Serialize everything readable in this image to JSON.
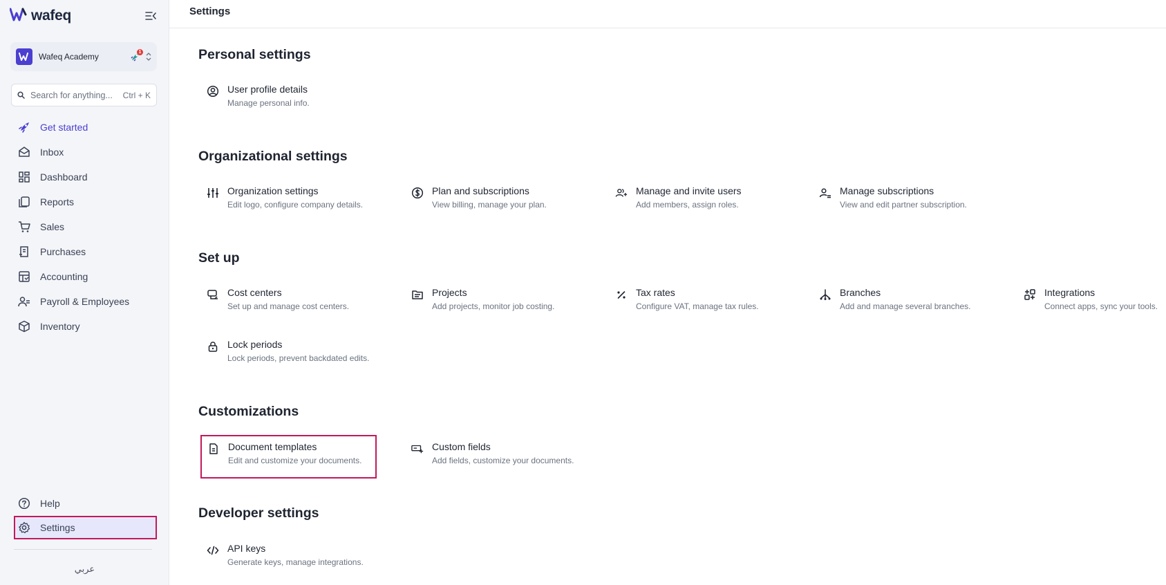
{
  "sidebar": {
    "logo_text": "wafeq",
    "org_name": "Wafeq Academy",
    "org_badge": "1",
    "search_placeholder": "Search for anything...",
    "search_shortcut": "Ctrl + K",
    "nav_items": [
      {
        "label": "Get started",
        "icon": "rocket-icon"
      },
      {
        "label": "Inbox",
        "icon": "inbox-icon"
      },
      {
        "label": "Dashboard",
        "icon": "dashboard-icon"
      },
      {
        "label": "Reports",
        "icon": "reports-icon"
      },
      {
        "label": "Sales",
        "icon": "cart-icon"
      },
      {
        "label": "Purchases",
        "icon": "receipt-icon"
      },
      {
        "label": "Accounting",
        "icon": "ledger-icon"
      },
      {
        "label": "Payroll & Employees",
        "icon": "people-icon"
      },
      {
        "label": "Inventory",
        "icon": "box-icon"
      }
    ],
    "help_label": "Help",
    "settings_label": "Settings",
    "language_label": "عربي"
  },
  "header": {
    "title": "Settings"
  },
  "sections": {
    "personal": {
      "title": "Personal settings",
      "items": [
        {
          "title": "User profile details",
          "desc": "Manage personal info."
        }
      ]
    },
    "organizational": {
      "title": "Organizational settings",
      "items": [
        {
          "title": "Organization settings",
          "desc": "Edit logo, configure company details."
        },
        {
          "title": "Plan and subscriptions",
          "desc": "View billing, manage your plan."
        },
        {
          "title": "Manage and invite users",
          "desc": "Add members, assign roles."
        },
        {
          "title": "Manage subscriptions",
          "desc": "View and edit partner subscription."
        }
      ]
    },
    "setup": {
      "title": "Set up",
      "items": [
        {
          "title": "Cost centers",
          "desc": "Set up and manage cost centers."
        },
        {
          "title": "Projects",
          "desc": "Add projects, monitor job costing."
        },
        {
          "title": "Tax rates",
          "desc": "Configure VAT, manage tax rules."
        },
        {
          "title": "Branches",
          "desc": "Add and manage several branches."
        },
        {
          "title": "Integrations",
          "desc": "Connect apps, sync your tools."
        },
        {
          "title": "Lock periods",
          "desc": "Lock periods, prevent backdated edits."
        }
      ]
    },
    "customizations": {
      "title": "Customizations",
      "items": [
        {
          "title": "Document templates",
          "desc": "Edit and customize your documents."
        },
        {
          "title": "Custom fields",
          "desc": "Add fields, customize your documents."
        }
      ]
    },
    "developer": {
      "title": "Developer settings",
      "items": [
        {
          "title": "API keys",
          "desc": "Generate keys, manage integrations."
        }
      ]
    }
  },
  "colors": {
    "accent": "#4a3fd0",
    "highlight": "#c2185b",
    "sidebar_bg": "#f4f5f8",
    "muted_text": "#6b7280"
  }
}
